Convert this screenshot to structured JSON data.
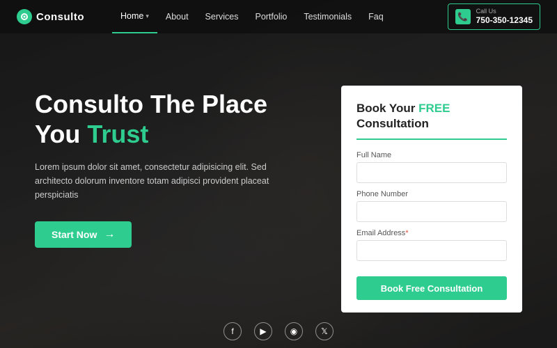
{
  "brand": {
    "name": "Consulto"
  },
  "navbar": {
    "links": [
      {
        "label": "Home",
        "active": true,
        "hasDropdown": true
      },
      {
        "label": "About",
        "active": false,
        "hasDropdown": false
      },
      {
        "label": "Services",
        "active": false,
        "hasDropdown": false
      },
      {
        "label": "Portfolio",
        "active": false,
        "hasDropdown": false
      },
      {
        "label": "Testimonials",
        "active": false,
        "hasDropdown": false
      },
      {
        "label": "Faq",
        "active": false,
        "hasDropdown": false
      }
    ],
    "phone": {
      "call_us": "Call Us",
      "number": "750-350-12345"
    }
  },
  "hero": {
    "title_line1": "Consulto The Place",
    "title_line2": "You ",
    "title_trust": "Trust",
    "description": "Lorem ipsum dolor sit amet, consectetur adipisicing elit. Sed architecto dolorum inventore totam adipisci provident placeat perspiciatis",
    "cta_label": "Start Now",
    "cta_arrow": "→"
  },
  "form": {
    "title_prefix": "Book Your ",
    "title_free": "FREE",
    "title_suffix": " Consultation",
    "fields": [
      {
        "label": "Full Name",
        "required": false,
        "placeholder": ""
      },
      {
        "label": "Phone Number",
        "required": false,
        "placeholder": ""
      },
      {
        "label": "Email Address",
        "required": true,
        "placeholder": ""
      }
    ],
    "submit_label": "Book Free Consultation"
  },
  "social": {
    "icons": [
      {
        "name": "facebook",
        "symbol": "f"
      },
      {
        "name": "youtube",
        "symbol": "▶"
      },
      {
        "name": "instagram",
        "symbol": "◉"
      },
      {
        "name": "twitter",
        "symbol": "t"
      }
    ]
  },
  "colors": {
    "accent": "#2ecc8f",
    "dark": "#1a1a1a",
    "white": "#ffffff"
  }
}
